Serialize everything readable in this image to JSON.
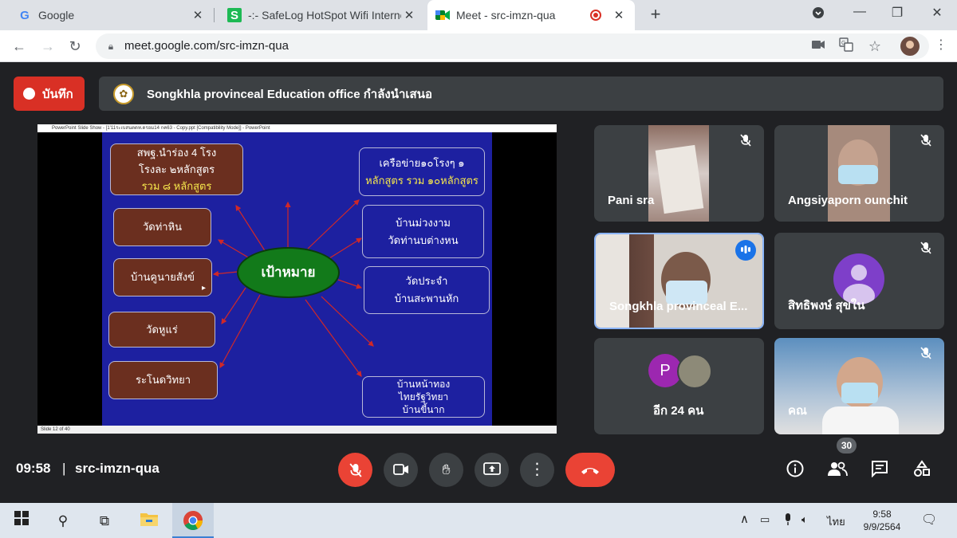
{
  "browser": {
    "tabs": [
      {
        "title": "Google",
        "favicon": "G",
        "active": false
      },
      {
        "title": "-:- SafeLog HotSpot Wifi Internet",
        "favicon": "S",
        "active": false
      },
      {
        "title": "Meet - src-imzn-qua",
        "favicon": "meet-icon",
        "active": true
      }
    ],
    "url": "meet.google.com/src-imzn-qua",
    "accent": "#dee1e6"
  },
  "meet": {
    "record_label": "บันทึก",
    "presenting_text": "Songkhla provinceal Education office กำลังนำเสนอ",
    "slide": {
      "ppt_title": "PowerPoint Slide Show - [1'11ระเบสนตดท.ดรอม14 กค63 - Copy.ppt [Compatibility Mode]] - PowerPoint",
      "status": "Slide 12 of 40",
      "center": "เป้าหมาย",
      "left_boxes": [
        {
          "lines": [
            "สพฐ.นำร่อง 4 โรง",
            "โรงละ ๒หลักสูตร"
          ],
          "highlight": "รวม ๘ หลักสูตร"
        },
        {
          "lines": [
            "วัดท่าหิน"
          ]
        },
        {
          "lines": [
            "บ้านคูนายสังข์"
          ]
        },
        {
          "lines": [
            "วัดหูแร่"
          ]
        },
        {
          "lines": [
            "ระโนดวิทยา"
          ]
        }
      ],
      "right_boxes": [
        {
          "lines": [
            "เครือข่าย๑๐โรงๆ ๑"
          ],
          "highlight": "หลักสูตร รวม ๑๐หลักสูตร"
        },
        {
          "lines": [
            "บ้านม่วงงาม",
            "วัดท่านบต่างหน"
          ]
        },
        {
          "lines": [
            "วัดประจำ",
            "บ้านสะพานหัก"
          ]
        },
        {
          "lines": [
            "บ้านหน้าทอง",
            "ไทยรัฐวิทยา",
            "บ้านขี้นาก"
          ]
        }
      ]
    },
    "participants": [
      {
        "name": "Pani sra",
        "muted": true
      },
      {
        "name": "Angsiyaporn ounchit",
        "muted": true
      },
      {
        "name": "Songkhla provinceal E...",
        "muted": false,
        "speaking": true
      },
      {
        "name": "สิทธิพงษ์ สุขใน",
        "muted": true
      },
      {
        "name": "อีก 24 คน",
        "avatar_letter": "P"
      },
      {
        "name": "คณ",
        "muted": true
      }
    ],
    "time": "09:58",
    "meeting_code": "src-imzn-qua",
    "people_count": "30",
    "end_color": "#ea4335"
  },
  "taskbar": {
    "time": "9:58",
    "date": "9/9/2564",
    "lang": "ไทย"
  }
}
